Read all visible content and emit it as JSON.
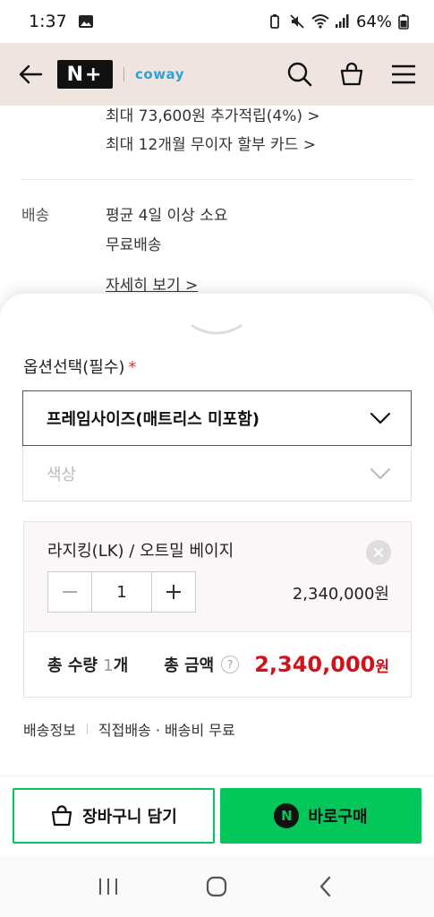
{
  "status_bar": {
    "time": "1:37",
    "battery": "64%"
  },
  "header": {
    "logo": "N+",
    "brand": "coway"
  },
  "benefits": [
    "최대 73,600원 추가적립(4%) >",
    "최대 12개월 무이자 할부 카드 >"
  ],
  "delivery": {
    "label": "배송",
    "lines": [
      "평균 4일 이상 소요",
      "무료배송"
    ],
    "details_link": "자세히 보기 >"
  },
  "options": {
    "title": "옵션선택(필수)",
    "required_mark": "*",
    "select_frame": "프레임사이즈(매트리스 미포함)",
    "select_color_placeholder": "색상"
  },
  "selected_item": {
    "name": "라지킹(LK) / 오트밀 베이지",
    "quantity": "1",
    "price": "2,340,000원"
  },
  "totals": {
    "qty_label": "총 수량",
    "qty_value": "1",
    "qty_unit": "개",
    "amount_label": "총 금액",
    "help": "?",
    "amount": "2,340,000",
    "amount_unit": "원"
  },
  "shipping_info": {
    "label": "배송정보",
    "value": "직접배송 · 배송비 무료"
  },
  "footer": {
    "cart_label": "장바구니 담기",
    "buy_label": "바로구매",
    "buy_badge": "N"
  },
  "colors": {
    "naver_green": "#03c75a",
    "price_red": "#d0121b",
    "header_bg": "#efe4e0"
  }
}
